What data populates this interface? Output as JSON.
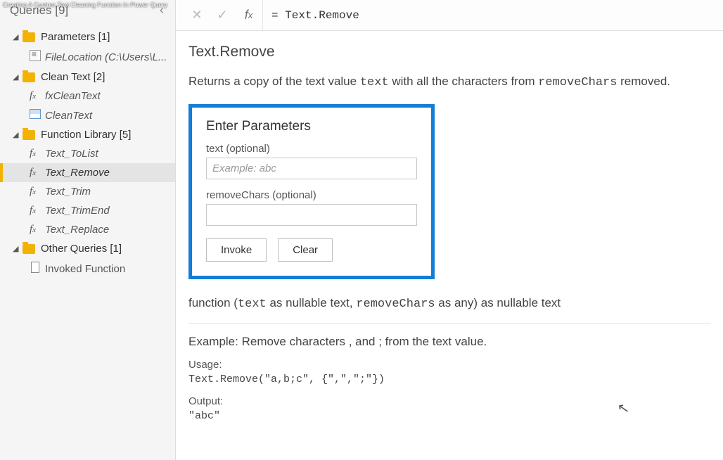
{
  "watermark": "Creating A Custom Text Cleaning Function In Power Query",
  "sidebar": {
    "title": "Queries [9]",
    "groups": [
      {
        "label": "Parameters [1]",
        "items": [
          {
            "kind": "param",
            "label": "FileLocation (C:\\Users\\L...",
            "italic": true
          }
        ]
      },
      {
        "label": "Clean Text [2]",
        "items": [
          {
            "kind": "fx",
            "label": "fxCleanText",
            "italic": true
          },
          {
            "kind": "table",
            "label": "CleanText",
            "italic": true
          }
        ]
      },
      {
        "label": "Function Library [5]",
        "items": [
          {
            "kind": "fx",
            "label": "Text_ToList",
            "italic": true
          },
          {
            "kind": "fx",
            "label": "Text_Remove",
            "italic": true,
            "selected": true
          },
          {
            "kind": "fx",
            "label": "Text_Trim",
            "italic": true
          },
          {
            "kind": "fx",
            "label": "Text_TrimEnd",
            "italic": true
          },
          {
            "kind": "fx",
            "label": "Text_Replace",
            "italic": true
          }
        ]
      },
      {
        "label": "Other Queries [1]",
        "items": [
          {
            "kind": "doc",
            "label": "Invoked Function",
            "italic": false
          }
        ]
      }
    ]
  },
  "formula": "= Text.Remove",
  "func": {
    "name": "Text.Remove",
    "desc_pre": "Returns a copy of the text value ",
    "desc_code1": "text",
    "desc_mid": " with all the characters from ",
    "desc_code2": "removeChars",
    "desc_post": " removed.",
    "params_header": "Enter Parameters",
    "param1_label": "text (optional)",
    "param1_placeholder": "Example: abc",
    "param2_label": "removeChars (optional)",
    "param2_placeholder": "",
    "invoke_btn": "Invoke",
    "clear_btn": "Clear",
    "sig_pre": "function (",
    "sig_code1": "text",
    "sig_mid1": " as nullable text, ",
    "sig_code2": "removeChars",
    "sig_mid2": " as any) as nullable text",
    "example_title": "Example: Remove characters , and ; from the text value.",
    "usage_label": "Usage:",
    "usage_code": "Text.Remove(\"a,b;c\", {\",\",\";\"})",
    "output_label": "Output:",
    "output_code": "\"abc\""
  }
}
